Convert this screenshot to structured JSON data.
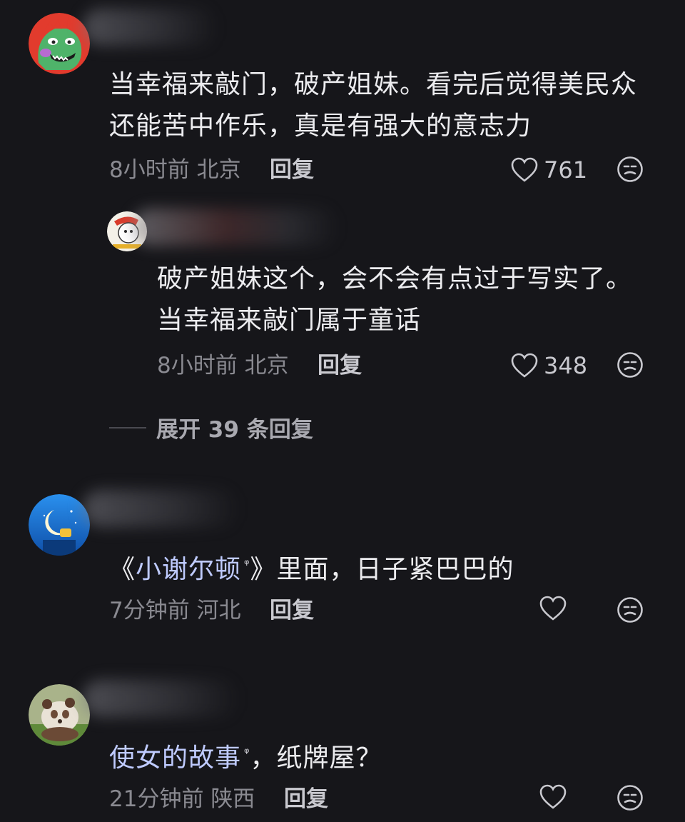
{
  "comments": [
    {
      "text_line1": "当幸福来敲门，破产姐妹。看完后觉得美民众",
      "text_line2": "还能苦中作乐，真是有强大的意志力",
      "time": "8小时前",
      "location": "北京",
      "reply_label": "回复",
      "likes": "761",
      "avatar_icon": "dinosaur-avatar-icon",
      "avatar_color": "#e23b2d"
    },
    {
      "text_line1": "破产姐妹这个，会不会有点过于写实了。",
      "text_line2": "当幸福来敲门属于童话",
      "time": "8小时前",
      "location": "北京",
      "reply_label": "回复",
      "likes": "348",
      "avatar_icon": "cartoon-avatar-icon"
    },
    {
      "text_prefix": "《",
      "text_link": "小谢尔顿",
      "text_suffix": "》里面，日子紧巴巴的",
      "time": "7分钟前",
      "location": "河北",
      "reply_label": "回复",
      "likes": "",
      "avatar_icon": "moon-avatar-icon",
      "avatar_color": "#1f7fe0"
    },
    {
      "text_link": "使女的故事",
      "text_suffix": "，纸牌屋？",
      "time": "21分钟前",
      "location": "陕西",
      "reply_label": "回复",
      "avatar_icon": "panda-avatar-icon"
    }
  ],
  "expand_replies": "展开 39 条回复",
  "search_mark": "ᵠ"
}
